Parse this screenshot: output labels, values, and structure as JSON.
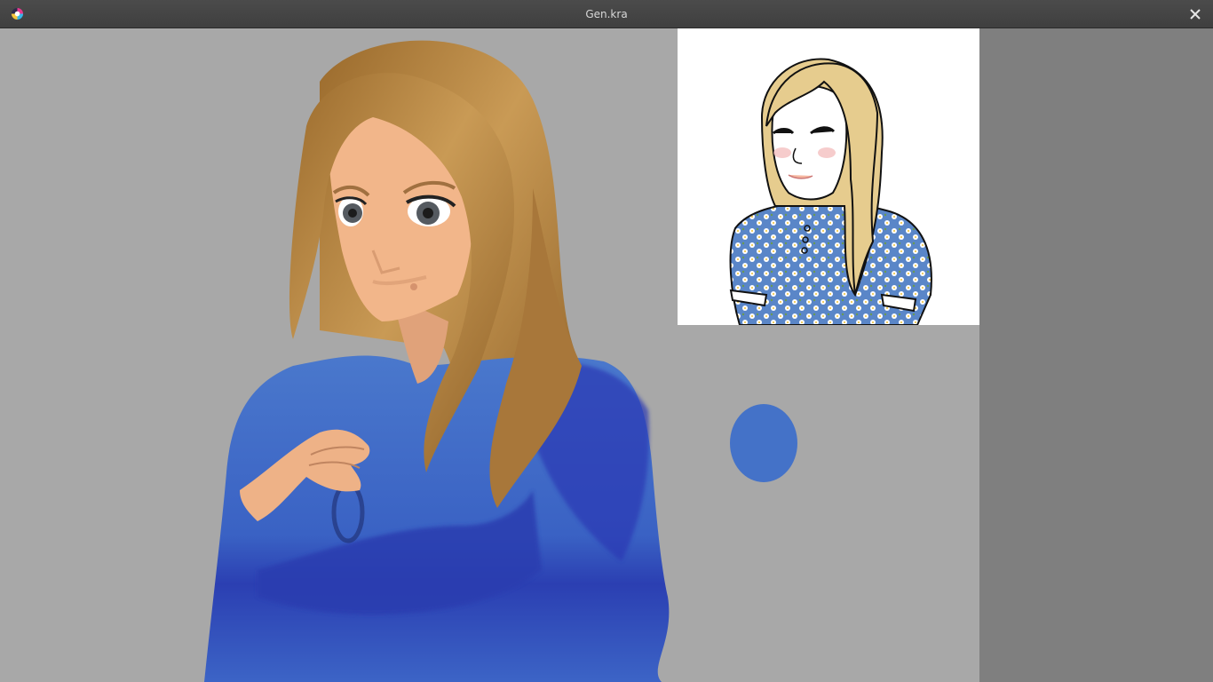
{
  "window": {
    "title": "Gen.kra",
    "app_icon": "krita-logo-icon",
    "close_icon": "close-icon"
  },
  "canvas": {
    "background": "#a8a8a8",
    "outer_background": "#7f7f7f"
  },
  "colors": {
    "dress_blue": "#4472c8",
    "dress_shadow": "#2a3fb0",
    "hair": "#b98a45",
    "skin": "#f0b48a",
    "reference_hair": "#e6cc8e"
  }
}
